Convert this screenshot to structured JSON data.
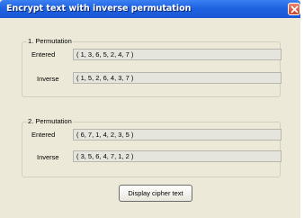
{
  "window": {
    "title": "Encrypt text with inverse permutation"
  },
  "groups": [
    {
      "legend": "1. Permutation",
      "entered_label": "Entered",
      "entered_value": "( 1, 3, 6, 5, 2, 4, 7 )",
      "inverse_label": "Inverse",
      "inverse_value": "( 1, 5, 2, 6, 4, 3, 7 )"
    },
    {
      "legend": "2. Permutation",
      "entered_label": "Entered",
      "entered_value": "( 6, 7, 1, 4, 2, 3, 5 )",
      "inverse_label": "Inverse",
      "inverse_value": "( 3, 5, 6, 4, 7, 1, 2 )"
    }
  ],
  "actions": {
    "display_label": "Display cipher text"
  },
  "icons": {
    "close": "close-icon"
  },
  "colors": {
    "titlebar": "#1f63e0",
    "close": "#c8452a",
    "dialog_bg": "#ece9d8"
  }
}
